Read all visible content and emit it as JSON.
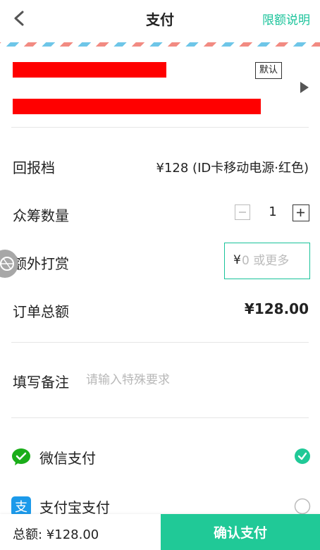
{
  "header": {
    "title": "支付",
    "limit_link": "限额说明"
  },
  "address": {
    "default_badge": "默认"
  },
  "reward": {
    "label": "回报档",
    "value": "¥128 (ID卡移动电源·红色)"
  },
  "quantity": {
    "label": "众筹数量",
    "value": "1"
  },
  "tip": {
    "label": "额外打赏",
    "currency": "¥",
    "placeholder": "0 或更多",
    "value": ""
  },
  "total": {
    "label": "订单总额",
    "value": "¥128.00"
  },
  "note": {
    "label": "填写备注",
    "placeholder": "请输入特殊要求",
    "value": ""
  },
  "payment": {
    "methods": [
      {
        "label": "微信支付",
        "icon": "wechat-pay-icon",
        "selected": true
      },
      {
        "label": "支付宝支付",
        "icon": "alipay-icon",
        "selected": false
      }
    ]
  },
  "footer": {
    "total_text": "总额: ¥128.00",
    "confirm_label": "确认支付"
  },
  "colors": {
    "accent": "#20c997",
    "link": "#19c39a",
    "redaction": "#ff0000"
  }
}
